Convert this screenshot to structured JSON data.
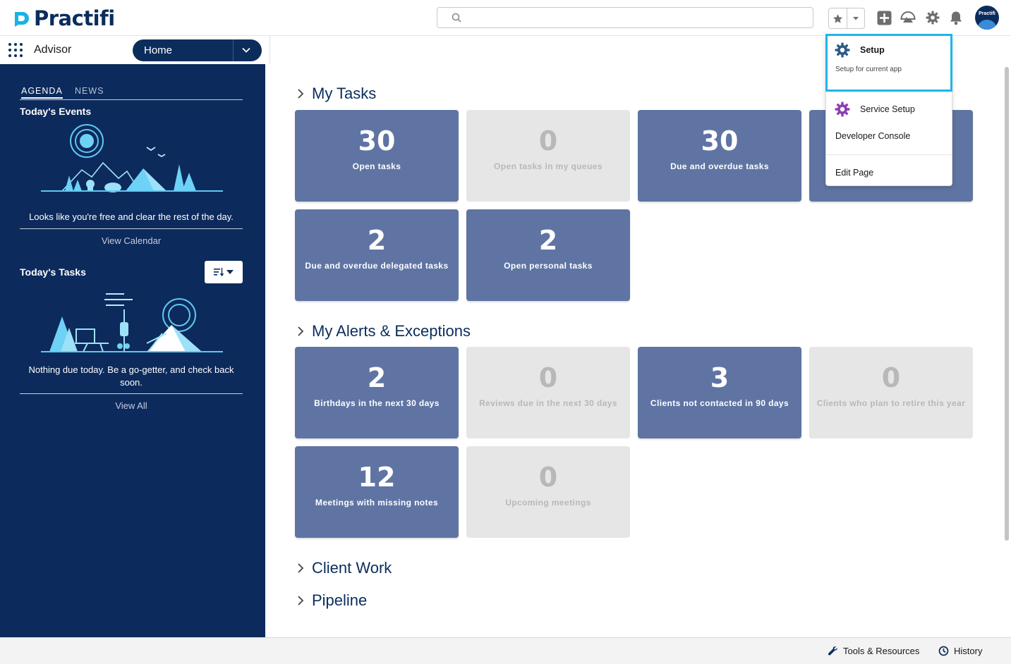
{
  "brand": {
    "name": "Practifi",
    "accent": "#0b2d5c",
    "highlight": "#1fb5ea"
  },
  "header": {
    "search_placeholder": "",
    "icons": [
      "search-icon",
      "star-icon",
      "chevron-down-icon",
      "plus-icon",
      "trailhead-icon",
      "gear-icon",
      "bell-icon"
    ],
    "avatar_label": "Practifi"
  },
  "nav": {
    "app_name": "Advisor",
    "current_tab": "Home"
  },
  "sidebar": {
    "tabs": [
      "AGENDA",
      "NEWS"
    ],
    "events_title": "Today's Events",
    "events_message": "Looks like you're free and clear the rest of the day.",
    "events_link": "View Calendar",
    "tasks_title": "Today's Tasks",
    "tasks_message": "Nothing due today. Be a go-getter, and check back soon.",
    "tasks_link": "View All"
  },
  "sections": {
    "my_tasks": {
      "title": "My Tasks",
      "tiles": [
        {
          "value": "30",
          "label": "Open tasks",
          "state": "active"
        },
        {
          "value": "0",
          "label": "Open tasks in my queues",
          "state": "inactive"
        },
        {
          "value": "30",
          "label": "Due and overdue tasks",
          "state": "active"
        },
        {
          "value": "",
          "label": "",
          "state": "active"
        },
        {
          "value": "2",
          "label": "Due and overdue delegated tasks",
          "state": "active"
        },
        {
          "value": "2",
          "label": "Open personal tasks",
          "state": "active"
        }
      ]
    },
    "alerts": {
      "title": "My Alerts & Exceptions",
      "tiles": [
        {
          "value": "2",
          "label": "Birthdays in the next 30 days",
          "state": "active"
        },
        {
          "value": "0",
          "label": "Reviews due in the next 30 days",
          "state": "inactive"
        },
        {
          "value": "3",
          "label": "Clients not contacted in 90 days",
          "state": "active"
        },
        {
          "value": "0",
          "label": "Clients who plan to retire this year",
          "state": "inactive"
        },
        {
          "value": "12",
          "label": "Meetings with missing notes",
          "state": "active"
        },
        {
          "value": "0",
          "label": "Upcoming meetings",
          "state": "inactive"
        }
      ]
    },
    "client_work": {
      "title": "Client Work"
    },
    "pipeline": {
      "title": "Pipeline"
    }
  },
  "setup_menu": {
    "setup_label": "Setup",
    "setup_sub": "Setup for current app",
    "service_setup": "Service Setup",
    "developer_console": "Developer Console",
    "edit_page": "Edit Page"
  },
  "footer": {
    "tools": "Tools & Resources",
    "history": "History"
  }
}
